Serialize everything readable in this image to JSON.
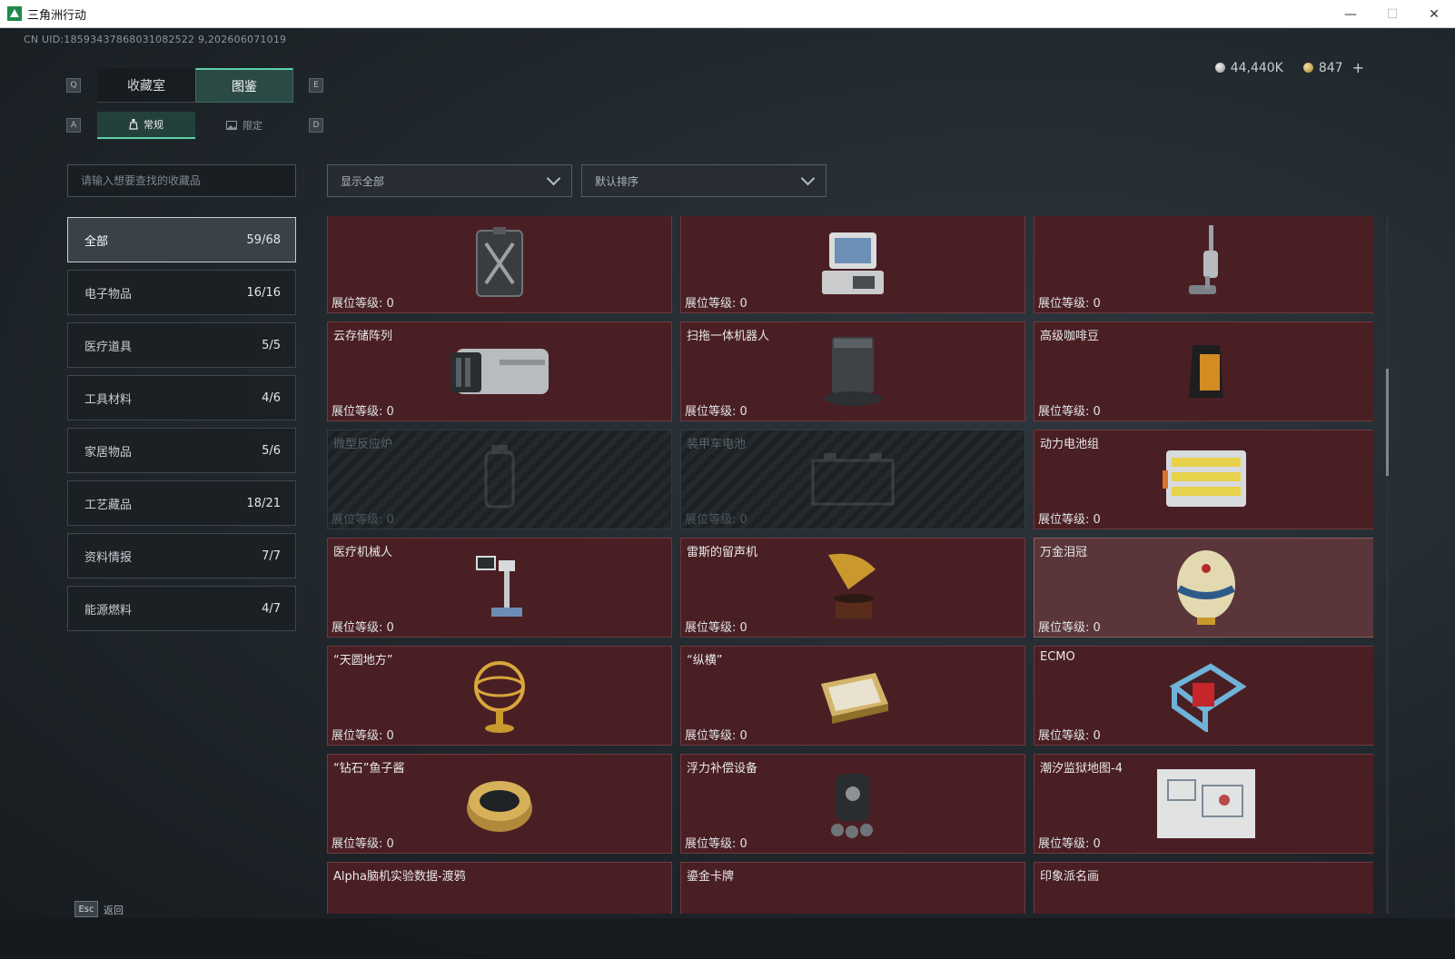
{
  "window": {
    "title": "三角洲行动",
    "minimize": "—",
    "maximize": "☐",
    "close": "✕"
  },
  "uid": "CN UID:18593437868031082522 9,202606071019",
  "currency": [
    {
      "icon": "silver-coin-icon",
      "value": "44,440K"
    },
    {
      "icon": "gold-coin-icon",
      "value": "847"
    }
  ],
  "currency_plus": "+",
  "hints": {
    "q": "Q",
    "e": "E",
    "a": "A",
    "d": "D",
    "esc": "Esc"
  },
  "tabs": [
    {
      "label": "收藏室",
      "active": false
    },
    {
      "label": "图鉴",
      "active": true
    }
  ],
  "subtabs": [
    {
      "label": "常规",
      "icon": "bottle-icon",
      "active": true
    },
    {
      "label": "限定",
      "icon": "image-icon",
      "active": false
    }
  ],
  "search": {
    "placeholder": "请输入想要查找的收藏品"
  },
  "filters": [
    {
      "value": "显示全部"
    },
    {
      "value": "默认排序"
    }
  ],
  "categories": [
    {
      "label": "全部",
      "count": "59/68",
      "active": true
    },
    {
      "label": "电子物品",
      "count": "16/16"
    },
    {
      "label": "医疗道具",
      "count": "5/5"
    },
    {
      "label": "工具材料",
      "count": "4/6"
    },
    {
      "label": "家居物品",
      "count": "5/6"
    },
    {
      "label": "工艺藏品",
      "count": "18/21"
    },
    {
      "label": "资料情报",
      "count": "7/7"
    },
    {
      "label": "能源燃料",
      "count": "4/7"
    }
  ],
  "level_label": "展位等级: 0",
  "items": [
    {
      "name": "",
      "icon": "jerrycan-icon"
    },
    {
      "name": "",
      "icon": "retro-computer-icon"
    },
    {
      "name": "",
      "icon": "vacuum-cleaner-icon"
    },
    {
      "name": "云存储阵列",
      "icon": "storage-array-icon"
    },
    {
      "name": "扫拖一体机器人",
      "icon": "mop-robot-icon"
    },
    {
      "name": "高级咖啡豆",
      "icon": "coffee-bag-icon"
    },
    {
      "name": "微型反应炉",
      "icon": "reactor-icon",
      "locked": true
    },
    {
      "name": "装甲车电池",
      "icon": "battery-box-icon",
      "locked": true
    },
    {
      "name": "动力电池组",
      "icon": "battery-pack-icon"
    },
    {
      "name": "医疗机械人",
      "icon": "medical-robot-icon"
    },
    {
      "name": "雷斯的留声机",
      "icon": "gramophone-icon"
    },
    {
      "name": "万金泪冠",
      "icon": "jeweled-egg-icon",
      "highlight": true
    },
    {
      "name": "“天圆地方”",
      "icon": "armillary-sphere-icon"
    },
    {
      "name": "“纵横”",
      "icon": "chess-board-icon"
    },
    {
      "name": "ECMO",
      "icon": "ecmo-machine-icon"
    },
    {
      "name": "“钻石”鱼子酱",
      "icon": "caviar-tin-icon"
    },
    {
      "name": "浮力补偿设备",
      "icon": "bcd-gear-icon"
    },
    {
      "name": "潮汐监狱地图-4",
      "icon": "map-sheet-icon"
    },
    {
      "name": "Alpha脑机实验数据-渡鸦",
      "icon": "data-device-icon"
    },
    {
      "name": "鎏金卡牌",
      "icon": "gilded-card-icon"
    },
    {
      "name": "印象派名画",
      "icon": "painting-frame-icon"
    }
  ],
  "footer": {
    "back_label": "返回"
  },
  "colors": {
    "accent": "#5fd1a9",
    "card_bg": "#4a1f24",
    "card_border": "#6b3a3f"
  }
}
